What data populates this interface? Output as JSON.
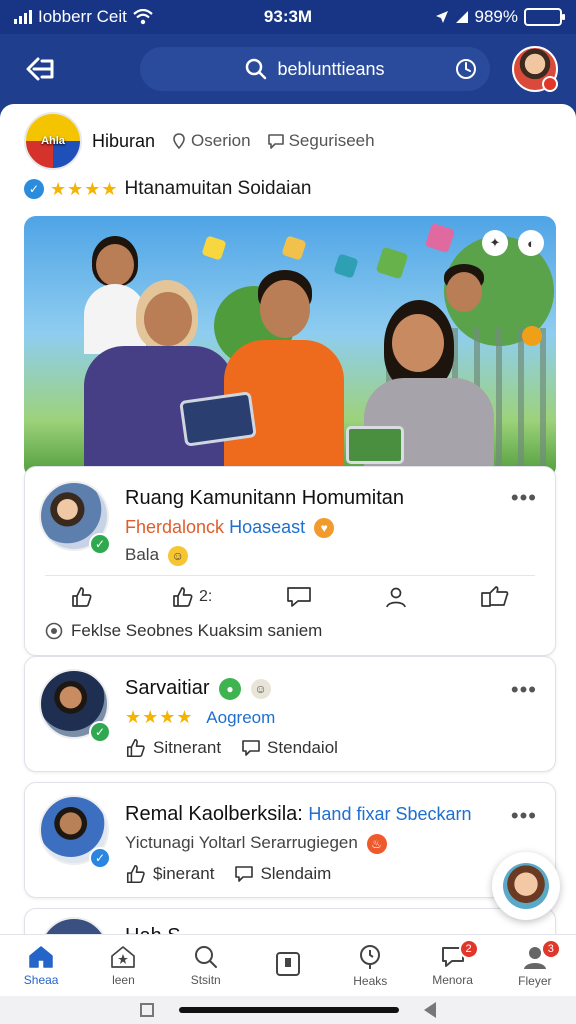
{
  "status_bar": {
    "carrier": "Iobberr Ceit",
    "time": "93:3M",
    "battery": "989%",
    "battery_level": 0.9
  },
  "header": {
    "search_text": "beblunttieans"
  },
  "group": {
    "name": "Hiburan",
    "chip1": "Oserion",
    "chip2": "Seguriseeh",
    "rating_label": "Htanamuitan Soidaian",
    "logo_text": "Ahla"
  },
  "posts": [
    {
      "title": "Ruang Kamunitann Homumitan",
      "subtitle_orange": "Fherdalonck",
      "subtitle_blue": "Hoaseast",
      "status": "Bala",
      "actions": [
        "",
        "2:",
        "",
        "",
        ""
      ],
      "footer": "Feklse Seobnes Kuaksim saniem"
    },
    {
      "title": "Sarvaitiar",
      "rating_text": "Aogreom",
      "like_label": "Sitnerant",
      "comment_label": "Stendaiol"
    },
    {
      "title": "Remal Kaolberksila:",
      "title_blue": "Hand fixar Sbeckarn",
      "subtitle": "Yictunagi Yoltarl Serarrugiegen",
      "like_label": "$inerant",
      "comment_label": "Slendaim"
    },
    {
      "title": "Hah S"
    }
  ],
  "bottom_nav": [
    {
      "label": "Sheaa",
      "icon": "home-icon"
    },
    {
      "label": "leen",
      "icon": "house-star-icon"
    },
    {
      "label": "Stsitn",
      "icon": "search-icon"
    },
    {
      "label": "",
      "icon": "square-icon"
    },
    {
      "label": "Heaks",
      "icon": "clock-pin-icon"
    },
    {
      "label": "Menora",
      "icon": "bell-icon",
      "badge": "2"
    },
    {
      "label": "Fleyer",
      "icon": "profile-icon",
      "badge": "3"
    }
  ],
  "colors": {
    "header_bg": "#1f3f8e",
    "accent": "#2565c9",
    "badge": "#e0372a",
    "star": "#f5b400"
  }
}
